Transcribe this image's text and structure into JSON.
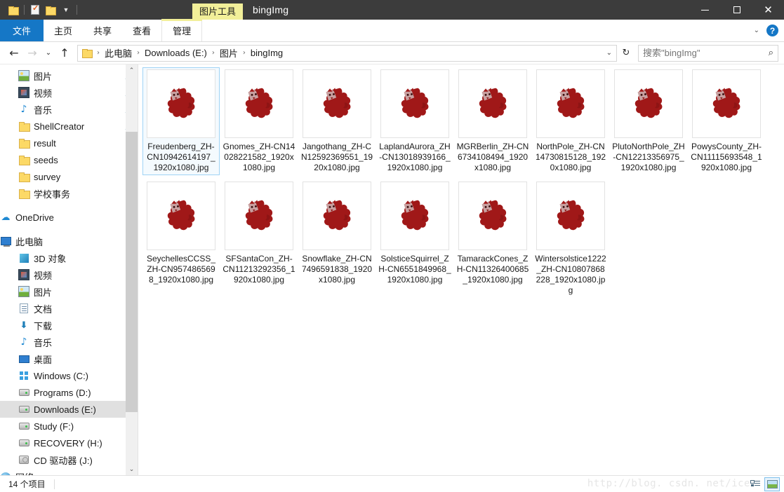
{
  "titlebar": {
    "quick_access": [
      {
        "name": "folder-icon",
        "label": "新建文件夹"
      },
      {
        "name": "properties-icon",
        "label": "属性"
      },
      {
        "name": "folder-icon",
        "label": "文件夹"
      },
      {
        "name": "chevron-down-icon",
        "label": "自定义快速访问工具栏"
      }
    ],
    "contextual_tab": "图片工具",
    "title": "bingImg",
    "minimize": "—",
    "maximize": "□",
    "close": "✕"
  },
  "ribbon": {
    "tabs": [
      {
        "label": "文件",
        "active_style": "file"
      },
      {
        "label": "主页",
        "active_style": "normal"
      },
      {
        "label": "共享",
        "active_style": "normal"
      },
      {
        "label": "查看",
        "active_style": "normal"
      },
      {
        "label": "管理",
        "active_style": "contextual"
      }
    ],
    "collapse_label": "⌄",
    "help_label": "?"
  },
  "addressbar": {
    "back": "←",
    "forward": "→",
    "recent": "⌄",
    "up": "↑",
    "crumbs": [
      "此电脑",
      "Downloads (E:)",
      "图片",
      "bingImg"
    ],
    "crumb_sep": "›",
    "dropdown": "⌄",
    "refresh": "↻",
    "search_placeholder": "搜索\"bingImg\"",
    "search_value": "",
    "search_icon": "⌕"
  },
  "sidebar": {
    "quick_access": [
      {
        "label": "图片",
        "icon": "picture-icon",
        "pinned": true,
        "indent": 1
      },
      {
        "label": "视频",
        "icon": "video-icon",
        "pinned": true,
        "indent": 1
      },
      {
        "label": "音乐",
        "icon": "music-icon",
        "pinned": true,
        "indent": 1
      },
      {
        "label": "ShellCreator",
        "icon": "folder-icon",
        "pinned": true,
        "indent": 1
      },
      {
        "label": "result",
        "icon": "folder-icon",
        "pinned": false,
        "indent": 1
      },
      {
        "label": "seeds",
        "icon": "folder-icon",
        "pinned": false,
        "indent": 1
      },
      {
        "label": "survey",
        "icon": "folder-icon",
        "pinned": false,
        "indent": 1
      },
      {
        "label": "学校事务",
        "icon": "folder-icon",
        "pinned": false,
        "indent": 1
      }
    ],
    "onedrive": {
      "label": "OneDrive",
      "icon": "onedrive-icon"
    },
    "this_pc": {
      "label": "此电脑",
      "icon": "computer-icon"
    },
    "this_pc_children": [
      {
        "label": "3D 对象",
        "icon": "3d-objects-icon"
      },
      {
        "label": "视频",
        "icon": "video-icon"
      },
      {
        "label": "图片",
        "icon": "picture-icon"
      },
      {
        "label": "文档",
        "icon": "documents-icon"
      },
      {
        "label": "下载",
        "icon": "downloads-icon"
      },
      {
        "label": "音乐",
        "icon": "music-icon"
      },
      {
        "label": "桌面",
        "icon": "desktop-icon"
      },
      {
        "label": "Windows (C:)",
        "icon": "windows-drive-icon"
      },
      {
        "label": "Programs (D:)",
        "icon": "drive-icon"
      },
      {
        "label": "Downloads (E:)",
        "icon": "drive-icon",
        "selected": true
      },
      {
        "label": "Study (F:)",
        "icon": "drive-icon"
      },
      {
        "label": "RECOVERY (H:)",
        "icon": "drive-icon"
      },
      {
        "label": "CD 驱动器 (J:)",
        "icon": "cd-drive-icon"
      }
    ],
    "network": {
      "label": "网络",
      "icon": "network-icon"
    },
    "scroll_up": "⌃",
    "scroll_down": "⌄"
  },
  "files": [
    {
      "name": "Freudenberg_ZH-CN10942614197_1920x1080.jpg",
      "selected": true
    },
    {
      "name": "Gnomes_ZH-CN14028221582_1920x1080.jpg",
      "selected": false
    },
    {
      "name": "Jangothang_ZH-CN12592369551_1920x1080.jpg",
      "selected": false
    },
    {
      "name": "LaplandAurora_ZH-CN13018939166_1920x1080.jpg",
      "selected": false
    },
    {
      "name": "MGRBerlin_ZH-CN6734108494_1920x1080.jpg",
      "selected": false
    },
    {
      "name": "NorthPole_ZH-CN14730815128_1920x1080.jpg",
      "selected": false
    },
    {
      "name": "PlutoNorthPole_ZH-CN12213356975_1920x1080.jpg",
      "selected": false
    },
    {
      "name": "PowysCounty_ZH-CN11115693548_1920x1080.jpg",
      "selected": false
    },
    {
      "name": "SeychellesCCSS_ZH-CN9574865698_1920x1080.jpg",
      "selected": false
    },
    {
      "name": "SFSantaCon_ZH-CN11213292356_1920x1080.jpg",
      "selected": false
    },
    {
      "name": "Snowflake_ZH-CN7496591838_1920x1080.jpg",
      "selected": false
    },
    {
      "name": "SolsticeSquirrel_ZH-CN6551849968_1920x1080.jpg",
      "selected": false
    },
    {
      "name": "TamarackCones_ZH-CN11326400685_1920x1080.jpg",
      "selected": false
    },
    {
      "name": "Wintersolstice1222_ZH-CN10807868228_1920x1080.jpg",
      "selected": false
    }
  ],
  "statusbar": {
    "item_count": "14 个项目",
    "view_details": "详细信息",
    "view_large_icons": "大图标"
  },
  "watermark": "http://blog. csdn. net/ice",
  "colors": {
    "accent_blue": "#1577c6",
    "contextual_yellow": "#f2ef99",
    "titlebar_dark": "#3c3c3c",
    "selection_blue": "#9fd3f5",
    "thumb_red": "#a01818"
  }
}
